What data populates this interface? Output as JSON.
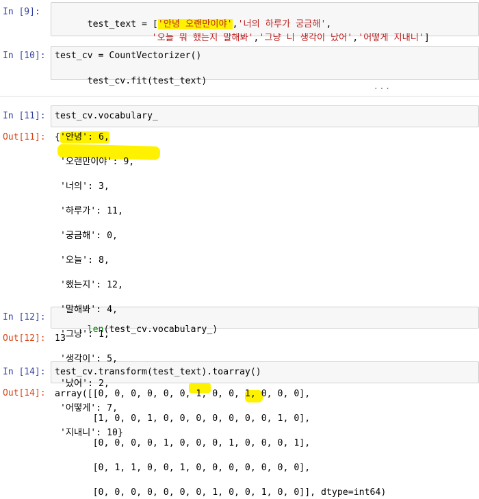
{
  "cells": {
    "c9": {
      "prompt": "In [9]:",
      "lines": [
        [
          "test_text = [",
          "'안녕 오랜만이야'",
          ",",
          "'너의 하루가 궁금해'",
          ","
        ],
        [
          "'오늘 뭐 했는지 말해봐'",
          ",",
          "'그냥 니 생각이 났어'",
          ",",
          "'어떻게 지내니'",
          "]"
        ]
      ]
    },
    "c10": {
      "prompt": "In [10]:",
      "line1": "test_cv = CountVectorizer()",
      "line2_a": "test_cv.fit(",
      "line2_b": "test_text",
      "line2_c": ")"
    },
    "ellipsis": "...",
    "c11": {
      "prompt": "In [11]:",
      "code": "test_cv.vocabulary_",
      "out_prompt": "Out[11]:",
      "output": [
        "{'안녕': 6,",
        " '오랜만이야': 9,",
        " '너의': 3,",
        " '하루가': 11,",
        " '궁금해': 0,",
        " '오늘': 8,",
        " '했는지': 12,",
        " '말해봐': 4,",
        " '그냥': 1,",
        " '생각이': 5,",
        " '났어': 2,",
        " '어떻게': 7,",
        " '지내니': 10}"
      ]
    },
    "c12": {
      "prompt": "In [12]:",
      "code_a": "len",
      "code_b": "(test_cv.vocabulary_)",
      "out_prompt": "Out[12]:",
      "output": "13"
    },
    "c14": {
      "prompt": "In [14]:",
      "code": "test_cv.transform(test_text).toarray()",
      "out_prompt": "Out[14]:",
      "output": [
        "array([[0, 0, 0, 0, 0, 0, 1, 0, 0, 1, 0, 0, 0],",
        "       [1, 0, 0, 1, 0, 0, 0, 0, 0, 0, 0, 1, 0],",
        "       [0, 0, 0, 0, 1, 0, 0, 0, 1, 0, 0, 0, 1],",
        "       [0, 1, 1, 0, 0, 1, 0, 0, 0, 0, 0, 0, 0],",
        "       [0, 0, 0, 0, 0, 0, 0, 1, 0, 0, 1, 0, 0]], dtype=int64)"
      ]
    }
  },
  "colors": {
    "in_prompt": "#303F9F",
    "out_prompt": "#D84315",
    "highlight": "#fff200",
    "cell_bg": "#f7f7f7"
  }
}
